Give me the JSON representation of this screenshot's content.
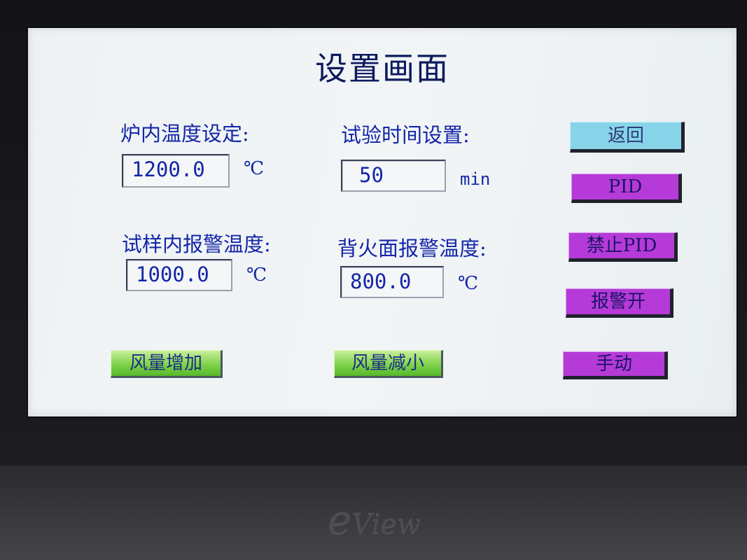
{
  "screen": {
    "title": "设置画面",
    "fields": {
      "furnace_temp_label": "炉内温度设定:",
      "furnace_temp_value": "1200.0",
      "furnace_temp_unit": "℃",
      "test_time_label": "试验时间设置:",
      "test_time_value": "50",
      "test_time_unit": "min",
      "sample_alarm_label": "试样内报警温度:",
      "sample_alarm_value": "1000.0",
      "sample_alarm_unit": "℃",
      "backfire_alarm_label": "背火面报警温度:",
      "backfire_alarm_value": "800.0",
      "backfire_alarm_unit": "℃"
    },
    "buttons": {
      "back": "返回",
      "pid": "PID",
      "disable_pid": "禁止PID",
      "alarm_on": "报警开",
      "airflow_up": "风量增加",
      "airflow_down": "风量减小",
      "manual": "手动"
    }
  },
  "brand": "View",
  "brand_mark": "e",
  "colors": {
    "label_text": "#1326a8",
    "cyan_button": "#87d4e8",
    "purple_button": "#b63ad8",
    "green_button": "#7fd24a"
  }
}
